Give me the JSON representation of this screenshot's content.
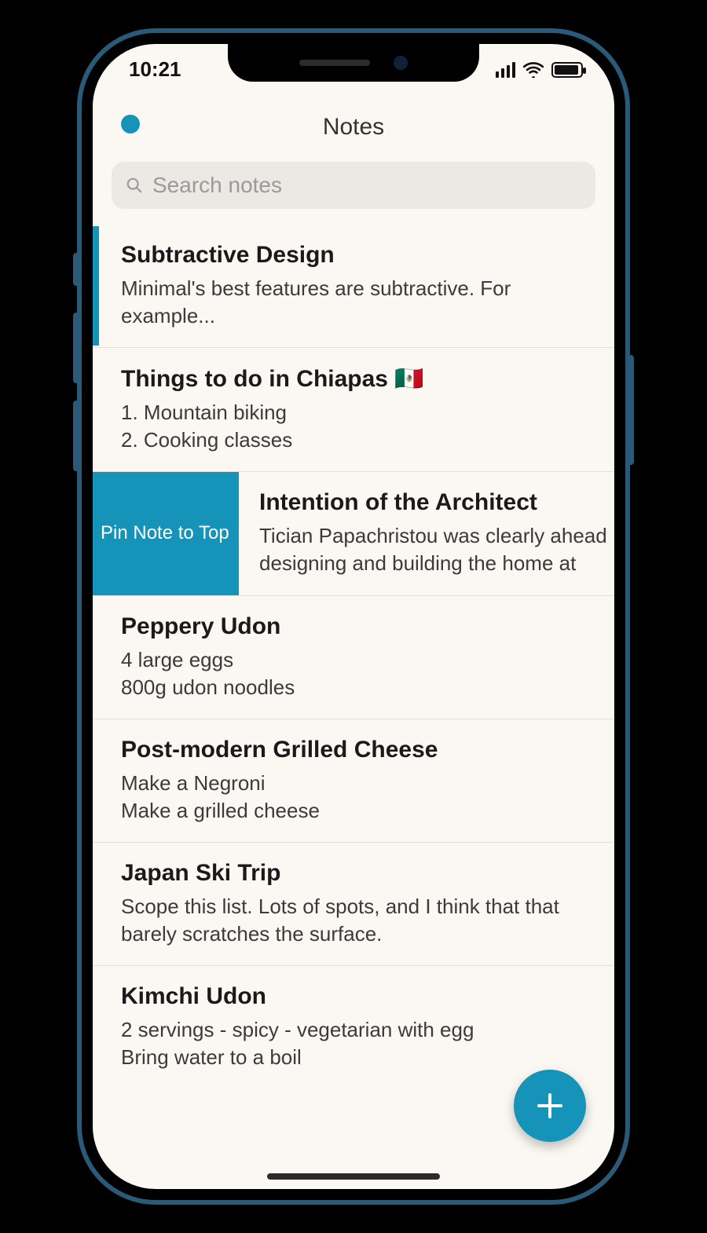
{
  "status": {
    "time": "10:21"
  },
  "nav": {
    "title": "Notes"
  },
  "search": {
    "placeholder": "Search notes"
  },
  "swipe": {
    "pin_label": "Pin Note to Top"
  },
  "fab": {
    "label": "Add note"
  },
  "notes": [
    {
      "title": "Subtractive Design",
      "preview_line1": "Minimal's best features are subtractive. For",
      "preview_line2": "example...",
      "selected": true
    },
    {
      "title": "Things to do in Chiapas 🇲🇽",
      "preview_line1": "1. Mountain biking",
      "preview_line2": "2. Cooking classes"
    },
    {
      "title": "Intention of the Architect",
      "preview_line1": "Tician Papachristou was clearly ahead",
      "preview_line2": "designing and building the home at",
      "swiped": true
    },
    {
      "title": "Peppery Udon",
      "preview_line1": "4 large eggs",
      "preview_line2": "800g udon noodles"
    },
    {
      "title": "Post-modern Grilled Cheese",
      "preview_line1": "Make a Negroni",
      "preview_line2": "Make a grilled cheese"
    },
    {
      "title": "Japan Ski Trip",
      "preview_line1": "Scope this list. Lots of spots, and I think that that",
      "preview_line2": "barely scratches the surface."
    },
    {
      "title": "Kimchi Udon",
      "preview_line1": "2 servings - spicy - vegetarian with egg",
      "preview_line2": "Bring water to a boil"
    }
  ]
}
